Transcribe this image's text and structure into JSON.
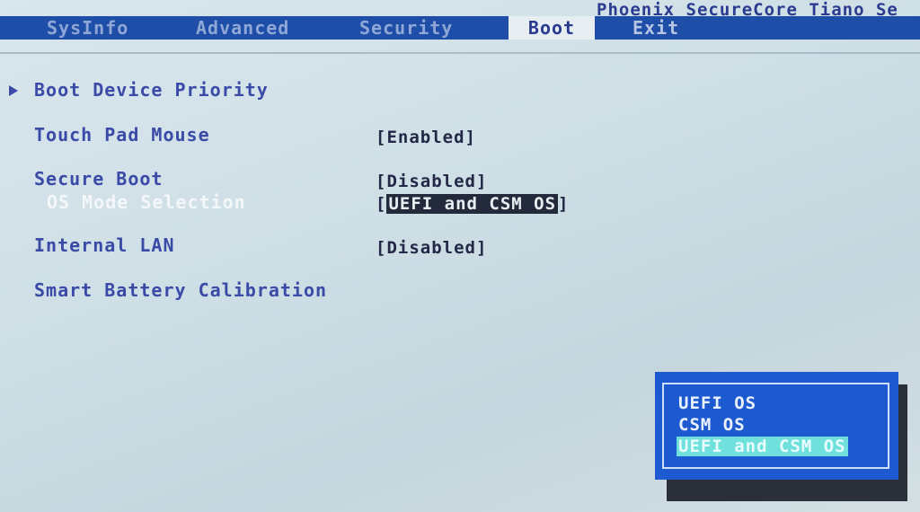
{
  "vendor_title": "Phoenix SecureCore Tiano Se",
  "tabs": [
    {
      "label": "SysInfo"
    },
    {
      "label": "Advanced"
    },
    {
      "label": "Security"
    },
    {
      "label": "Boot"
    },
    {
      "label": "Exit"
    }
  ],
  "active_tab": "Boot",
  "boot": {
    "boot_device_priority": "Boot Device Priority",
    "touch_pad_mouse": {
      "label": "Touch Pad Mouse",
      "value": "[Enabled]"
    },
    "secure_boot": {
      "label": "Secure Boot",
      "value": "[Disabled]"
    },
    "os_mode_selection": {
      "label": "OS Mode Selection",
      "open": "[",
      "value": "UEFI and CSM OS",
      "close": "]"
    },
    "internal_lan": {
      "label": "Internal LAN",
      "value": "[Disabled]"
    },
    "smart_battery": "Smart Battery Calibration"
  },
  "popup": {
    "options": [
      "UEFI OS",
      "CSM OS",
      "UEFI and CSM OS"
    ],
    "selected": "UEFI and CSM OS"
  },
  "colors": {
    "tabbar": "#1f4ea8",
    "popup": "#1d5ad0",
    "highlight": "#6fe0dc",
    "label": "#3a4aa7"
  }
}
